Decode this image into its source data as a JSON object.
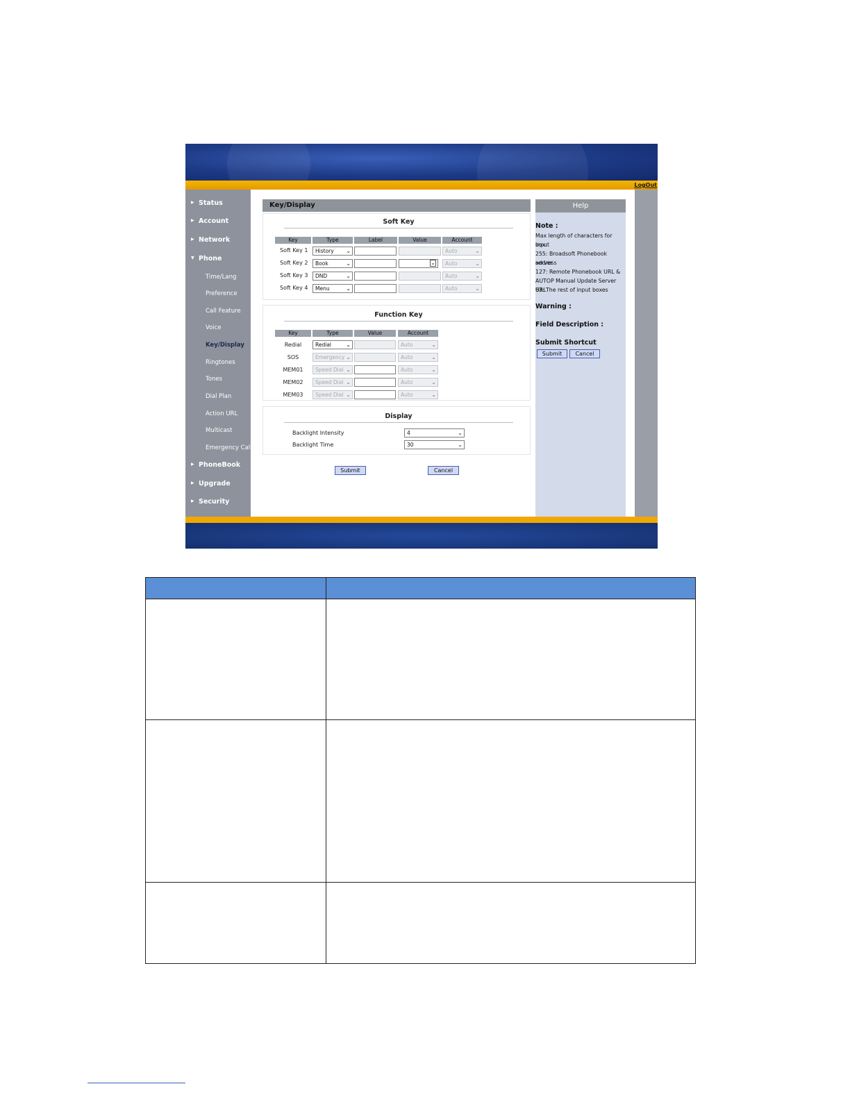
{
  "header": {
    "logout_label": "LogOut"
  },
  "sidebar": {
    "items": [
      {
        "label": "Status",
        "expanded": false
      },
      {
        "label": "Account",
        "expanded": false
      },
      {
        "label": "Network",
        "expanded": false
      },
      {
        "label": "Phone",
        "expanded": true
      },
      {
        "label": "PhoneBook",
        "expanded": false
      },
      {
        "label": "Upgrade",
        "expanded": false
      },
      {
        "label": "Security",
        "expanded": false
      }
    ],
    "phone_subitems": [
      "Time/Lang",
      "Preference",
      "Call Feature",
      "Voice",
      "Key/Display",
      "Ringtones",
      "Tones",
      "Dial Plan",
      "Action URL",
      "Multicast",
      "Emergency Call"
    ],
    "active_subitem": "Key/Display"
  },
  "main": {
    "title": "Key/Display",
    "soft_key": {
      "heading": "Soft Key",
      "columns": [
        "Key",
        "Type",
        "Label",
        "Value",
        "Account"
      ],
      "rows": [
        {
          "key": "Soft Key 1",
          "type": "History",
          "account": "Auto"
        },
        {
          "key": "Soft Key 2",
          "type": "Book",
          "account": "Auto"
        },
        {
          "key": "Soft Key 3",
          "type": "DND",
          "account": "Auto"
        },
        {
          "key": "Soft Key 4",
          "type": "Menu",
          "account": "Auto"
        }
      ]
    },
    "function_key": {
      "heading": "Function Key",
      "columns": [
        "Key",
        "Type",
        "Value",
        "Account"
      ],
      "rows": [
        {
          "key": "Redial",
          "type": "Redial",
          "account": "Auto"
        },
        {
          "key": "SOS",
          "type": "Emergency",
          "account": "Auto"
        },
        {
          "key": "MEM01",
          "type": "Speed Dial",
          "account": "Auto"
        },
        {
          "key": "MEM02",
          "type": "Speed Dial",
          "account": "Auto"
        },
        {
          "key": "MEM03",
          "type": "Speed Dial",
          "account": "Auto"
        }
      ]
    },
    "display": {
      "heading": "Display",
      "backlight_intensity_label": "Backlight Intensity",
      "backlight_intensity_value": "4",
      "backlight_time_label": "Backlight Time",
      "backlight_time_value": "30"
    },
    "submit_label": "Submit",
    "cancel_label": "Cancel"
  },
  "help": {
    "title": "Help",
    "note_heading": "Note :",
    "note_lines": [
      "Max length of characters for input",
      "box:",
      "255: Broadsoft Phonebook server",
      "address",
      "127: Remote Phonebook URL &",
      "AUTOP Manual Update Server URL",
      "63: The rest of input boxes"
    ],
    "warning_heading": "Warning :",
    "field_description_heading": "Field Description :",
    "submit_shortcut_heading": "Submit Shortcut",
    "submit_label": "Submit",
    "cancel_label": "Cancel"
  },
  "colors": {
    "banner_blue": "#1d3a86",
    "orange": "#f5b400",
    "sidebar_gray": "#8d929c",
    "help_bg": "#d3dae9",
    "button_bg": "#cfd9f7",
    "table_header_blue": "#5b8fd6"
  }
}
